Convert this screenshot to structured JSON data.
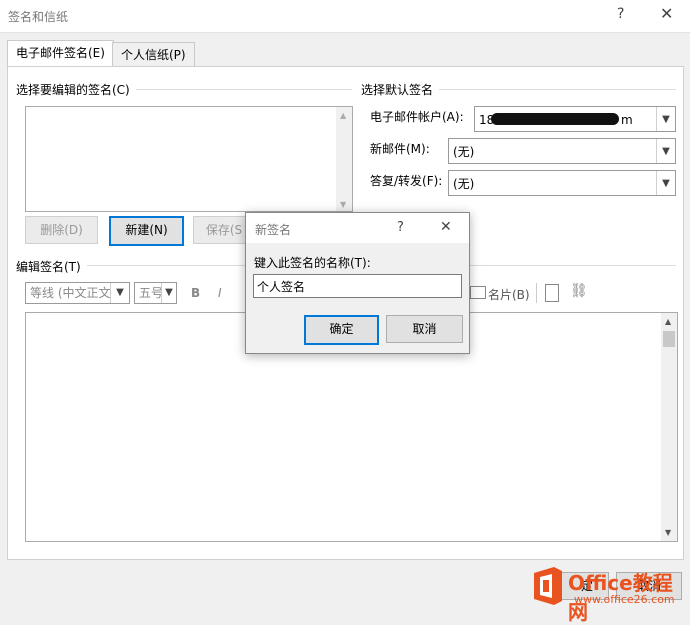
{
  "window": {
    "title": "签名和信纸",
    "help": "?",
    "close": "✕"
  },
  "tabs": [
    "电子邮件签名(E)",
    "个人信纸(P)"
  ],
  "left": {
    "section_title": "选择要编辑的签名(C)",
    "buttons": {
      "delete": "删除(D)",
      "new": "新建(N)",
      "save": "保存(S"
    }
  },
  "right": {
    "section_title": "选择默认签名",
    "account_label": "电子邮件帐户(A):",
    "account_value": "18",
    "account_suffix": "m",
    "new_mail_label": "新邮件(M):",
    "new_mail_value": "(无)",
    "reply_label": "答复/转发(F):",
    "reply_value": "(无)"
  },
  "edit": {
    "section_title": "编辑签名(T)",
    "font": "等线 (中文正文",
    "size": "五号",
    "bold": "B",
    "italic": "I",
    "business_card": "名片(B)"
  },
  "dialog": {
    "title": "新签名",
    "help": "?",
    "close": "✕",
    "prompt": "键入此签名的名称(T):",
    "value": "个人签名",
    "ok": "确定",
    "cancel": "取消"
  },
  "footer": {
    "ok_partial": "定",
    "cancel_partial": "取消"
  },
  "watermark": {
    "brand": "Office教程网",
    "url": "www.office26.com",
    "logo_color": "#e8531f"
  }
}
